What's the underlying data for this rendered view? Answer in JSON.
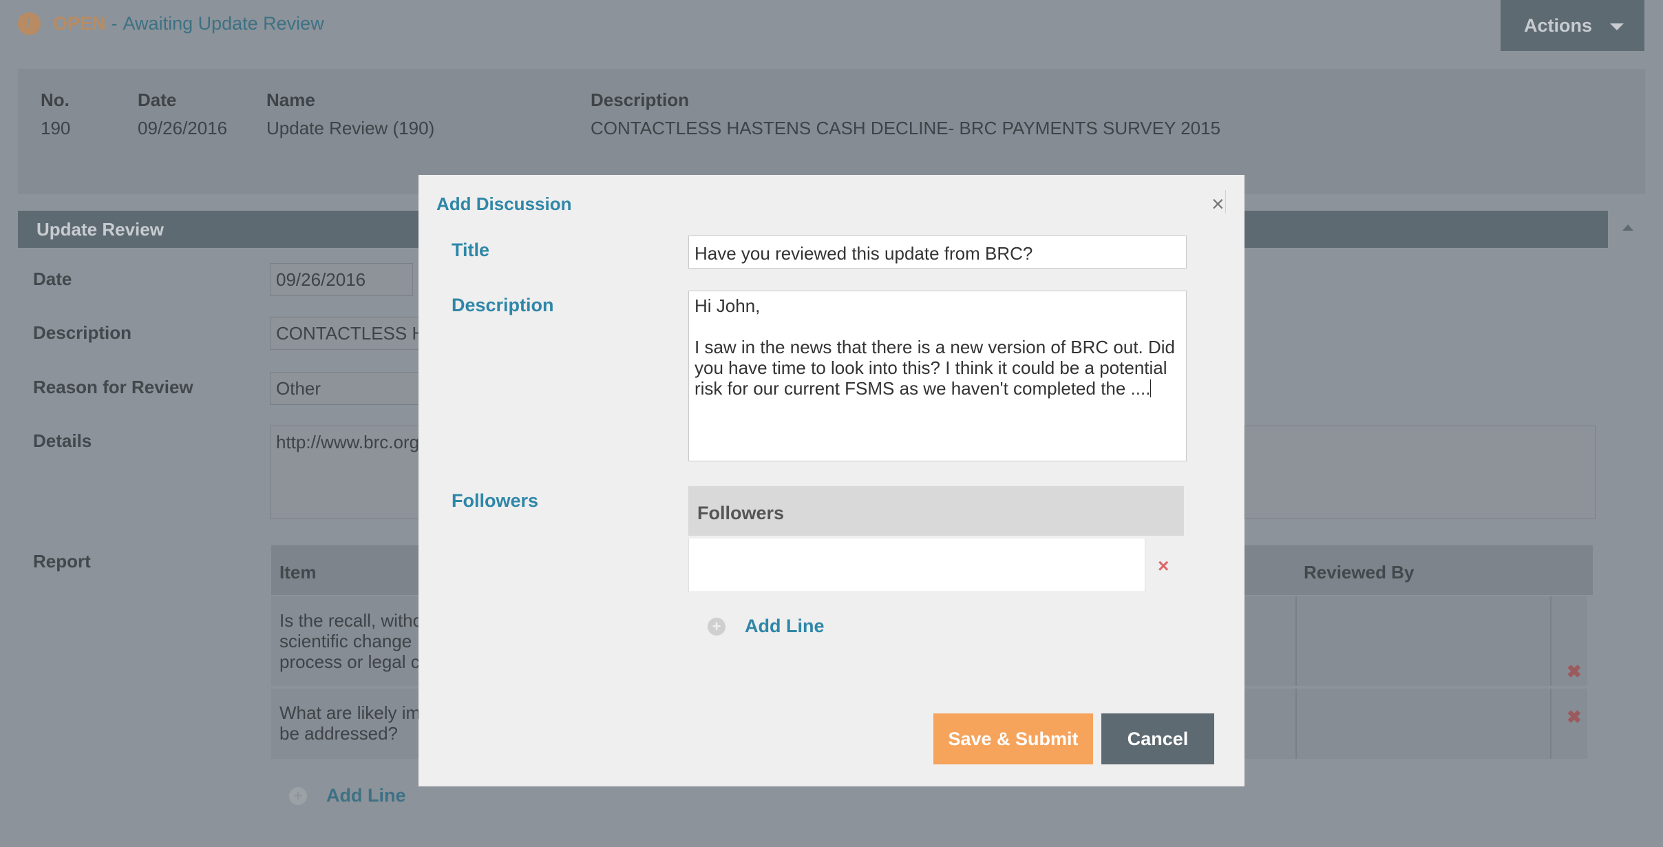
{
  "status": {
    "icon": "info-icon",
    "state": "OPEN",
    "separator": "-",
    "text": "Awaiting Update Review"
  },
  "actions": {
    "label": "Actions",
    "icon": "chevron-down-icon"
  },
  "summary": {
    "no_label": "No.",
    "no_value": "190",
    "date_label": "Date",
    "date_value": "09/26/2016",
    "name_label": "Name",
    "name_value": "Update Review (190)",
    "description_label": "Description",
    "description_value": "CONTACTLESS HASTENS CASH DECLINE- BRC PAYMENTS SURVEY 2015"
  },
  "section": {
    "title": "Update Review"
  },
  "form": {
    "date_label": "Date",
    "date_value": "09/26/2016",
    "description_label": "Description",
    "description_value": "CONTACTLESS H",
    "reason_label": "Reason for Review",
    "reason_value": "Other",
    "details_label": "Details",
    "details_value": "http://www.brc.org",
    "report_label": "Report"
  },
  "report": {
    "headers": {
      "item": "Item",
      "reviewed_by": "Reviewed By"
    },
    "rows": [
      {
        "item": "Is the recall, witho\nscientific change\nprocess or legal c"
      },
      {
        "item": "What are likely im\nbe addressed?"
      }
    ],
    "add_line": "Add Line"
  },
  "modal": {
    "title": "Add Discussion",
    "close": "×",
    "title_label": "Title",
    "title_value": "Have you reviewed this update from BRC?",
    "description_label": "Description",
    "description_value": "Hi John,\n\nI saw in the news that there is a new version of BRC out. Did you have time to look into this? I think it could be a potential risk for our current FSMS as we haven't completed the ....",
    "followers_label": "Followers",
    "followers_header": "Followers",
    "delete": "×",
    "add_line": "Add Line",
    "save_label": "Save & Submit",
    "cancel_label": "Cancel"
  }
}
